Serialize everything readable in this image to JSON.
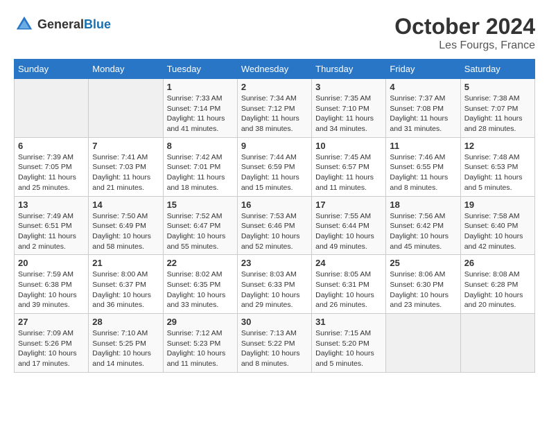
{
  "header": {
    "logo_general": "General",
    "logo_blue": "Blue",
    "month": "October 2024",
    "location": "Les Fourgs, France"
  },
  "days_of_week": [
    "Sunday",
    "Monday",
    "Tuesday",
    "Wednesday",
    "Thursday",
    "Friday",
    "Saturday"
  ],
  "weeks": [
    {
      "days": [
        {
          "num": "",
          "empty": true
        },
        {
          "num": "",
          "empty": true
        },
        {
          "num": "1",
          "sunrise": "Sunrise: 7:33 AM",
          "sunset": "Sunset: 7:14 PM",
          "daylight": "Daylight: 11 hours and 41 minutes."
        },
        {
          "num": "2",
          "sunrise": "Sunrise: 7:34 AM",
          "sunset": "Sunset: 7:12 PM",
          "daylight": "Daylight: 11 hours and 38 minutes."
        },
        {
          "num": "3",
          "sunrise": "Sunrise: 7:35 AM",
          "sunset": "Sunset: 7:10 PM",
          "daylight": "Daylight: 11 hours and 34 minutes."
        },
        {
          "num": "4",
          "sunrise": "Sunrise: 7:37 AM",
          "sunset": "Sunset: 7:08 PM",
          "daylight": "Daylight: 11 hours and 31 minutes."
        },
        {
          "num": "5",
          "sunrise": "Sunrise: 7:38 AM",
          "sunset": "Sunset: 7:07 PM",
          "daylight": "Daylight: 11 hours and 28 minutes."
        }
      ]
    },
    {
      "days": [
        {
          "num": "6",
          "sunrise": "Sunrise: 7:39 AM",
          "sunset": "Sunset: 7:05 PM",
          "daylight": "Daylight: 11 hours and 25 minutes."
        },
        {
          "num": "7",
          "sunrise": "Sunrise: 7:41 AM",
          "sunset": "Sunset: 7:03 PM",
          "daylight": "Daylight: 11 hours and 21 minutes."
        },
        {
          "num": "8",
          "sunrise": "Sunrise: 7:42 AM",
          "sunset": "Sunset: 7:01 PM",
          "daylight": "Daylight: 11 hours and 18 minutes."
        },
        {
          "num": "9",
          "sunrise": "Sunrise: 7:44 AM",
          "sunset": "Sunset: 6:59 PM",
          "daylight": "Daylight: 11 hours and 15 minutes."
        },
        {
          "num": "10",
          "sunrise": "Sunrise: 7:45 AM",
          "sunset": "Sunset: 6:57 PM",
          "daylight": "Daylight: 11 hours and 11 minutes."
        },
        {
          "num": "11",
          "sunrise": "Sunrise: 7:46 AM",
          "sunset": "Sunset: 6:55 PM",
          "daylight": "Daylight: 11 hours and 8 minutes."
        },
        {
          "num": "12",
          "sunrise": "Sunrise: 7:48 AM",
          "sunset": "Sunset: 6:53 PM",
          "daylight": "Daylight: 11 hours and 5 minutes."
        }
      ]
    },
    {
      "days": [
        {
          "num": "13",
          "sunrise": "Sunrise: 7:49 AM",
          "sunset": "Sunset: 6:51 PM",
          "daylight": "Daylight: 11 hours and 2 minutes."
        },
        {
          "num": "14",
          "sunrise": "Sunrise: 7:50 AM",
          "sunset": "Sunset: 6:49 PM",
          "daylight": "Daylight: 10 hours and 58 minutes."
        },
        {
          "num": "15",
          "sunrise": "Sunrise: 7:52 AM",
          "sunset": "Sunset: 6:47 PM",
          "daylight": "Daylight: 10 hours and 55 minutes."
        },
        {
          "num": "16",
          "sunrise": "Sunrise: 7:53 AM",
          "sunset": "Sunset: 6:46 PM",
          "daylight": "Daylight: 10 hours and 52 minutes."
        },
        {
          "num": "17",
          "sunrise": "Sunrise: 7:55 AM",
          "sunset": "Sunset: 6:44 PM",
          "daylight": "Daylight: 10 hours and 49 minutes."
        },
        {
          "num": "18",
          "sunrise": "Sunrise: 7:56 AM",
          "sunset": "Sunset: 6:42 PM",
          "daylight": "Daylight: 10 hours and 45 minutes."
        },
        {
          "num": "19",
          "sunrise": "Sunrise: 7:58 AM",
          "sunset": "Sunset: 6:40 PM",
          "daylight": "Daylight: 10 hours and 42 minutes."
        }
      ]
    },
    {
      "days": [
        {
          "num": "20",
          "sunrise": "Sunrise: 7:59 AM",
          "sunset": "Sunset: 6:38 PM",
          "daylight": "Daylight: 10 hours and 39 minutes."
        },
        {
          "num": "21",
          "sunrise": "Sunrise: 8:00 AM",
          "sunset": "Sunset: 6:37 PM",
          "daylight": "Daylight: 10 hours and 36 minutes."
        },
        {
          "num": "22",
          "sunrise": "Sunrise: 8:02 AM",
          "sunset": "Sunset: 6:35 PM",
          "daylight": "Daylight: 10 hours and 33 minutes."
        },
        {
          "num": "23",
          "sunrise": "Sunrise: 8:03 AM",
          "sunset": "Sunset: 6:33 PM",
          "daylight": "Daylight: 10 hours and 29 minutes."
        },
        {
          "num": "24",
          "sunrise": "Sunrise: 8:05 AM",
          "sunset": "Sunset: 6:31 PM",
          "daylight": "Daylight: 10 hours and 26 minutes."
        },
        {
          "num": "25",
          "sunrise": "Sunrise: 8:06 AM",
          "sunset": "Sunset: 6:30 PM",
          "daylight": "Daylight: 10 hours and 23 minutes."
        },
        {
          "num": "26",
          "sunrise": "Sunrise: 8:08 AM",
          "sunset": "Sunset: 6:28 PM",
          "daylight": "Daylight: 10 hours and 20 minutes."
        }
      ]
    },
    {
      "days": [
        {
          "num": "27",
          "sunrise": "Sunrise: 7:09 AM",
          "sunset": "Sunset: 5:26 PM",
          "daylight": "Daylight: 10 hours and 17 minutes."
        },
        {
          "num": "28",
          "sunrise": "Sunrise: 7:10 AM",
          "sunset": "Sunset: 5:25 PM",
          "daylight": "Daylight: 10 hours and 14 minutes."
        },
        {
          "num": "29",
          "sunrise": "Sunrise: 7:12 AM",
          "sunset": "Sunset: 5:23 PM",
          "daylight": "Daylight: 10 hours and 11 minutes."
        },
        {
          "num": "30",
          "sunrise": "Sunrise: 7:13 AM",
          "sunset": "Sunset: 5:22 PM",
          "daylight": "Daylight: 10 hours and 8 minutes."
        },
        {
          "num": "31",
          "sunrise": "Sunrise: 7:15 AM",
          "sunset": "Sunset: 5:20 PM",
          "daylight": "Daylight: 10 hours and 5 minutes."
        },
        {
          "num": "",
          "empty": true
        },
        {
          "num": "",
          "empty": true
        }
      ]
    }
  ]
}
